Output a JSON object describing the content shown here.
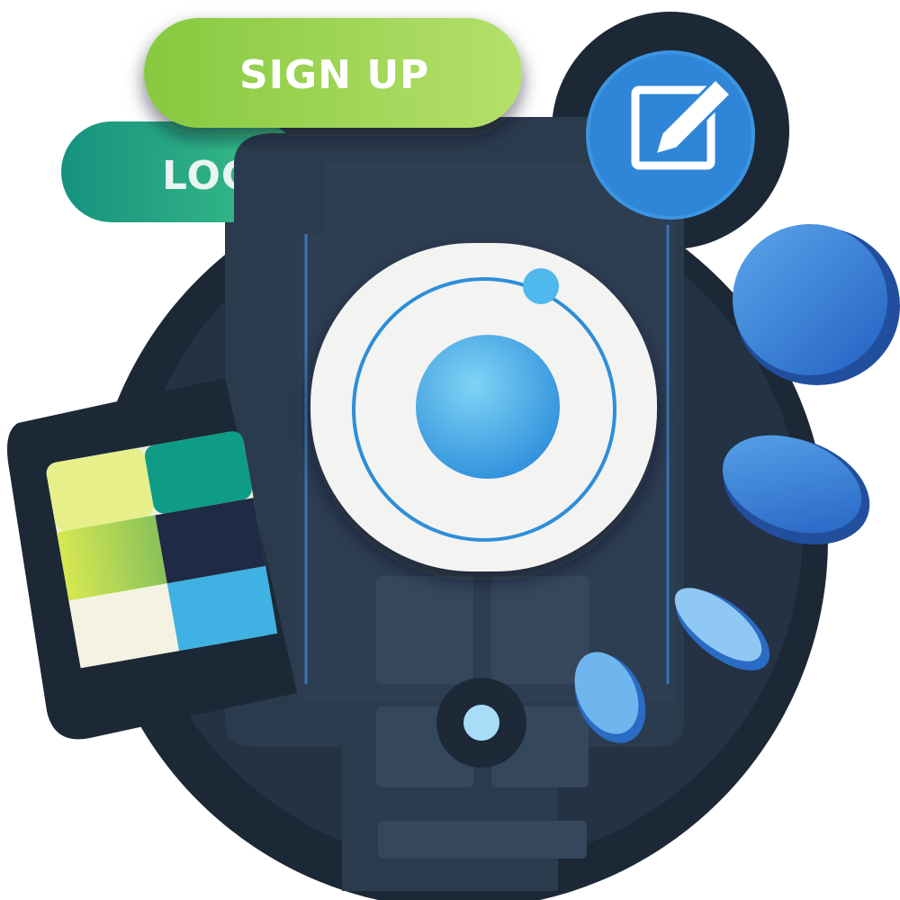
{
  "buttons": {
    "signup_label": "SIGN UP",
    "login_label": "LOG IN"
  },
  "icons": {
    "edit": "edit-icon",
    "logo": "ionic-logo-icon",
    "home": "home-button-icon",
    "palette": "color-palette-icon"
  },
  "colors": {
    "background": "#ffffff",
    "disc": "#1f2c3b",
    "phone": "#2a3a4c",
    "signup_green": "#9bd655",
    "login_teal": "#1a9b8a",
    "accent_blue": "#2f86d8",
    "logo_blue": "#4ab3ea",
    "swatch_yellow": "#e6ef8a",
    "swatch_teal": "#0f9c86",
    "swatch_lime": "#c7e049",
    "swatch_navy": "#1f2a44",
    "swatch_cream": "#f4f2e2",
    "swatch_sky": "#3fb1e2"
  }
}
